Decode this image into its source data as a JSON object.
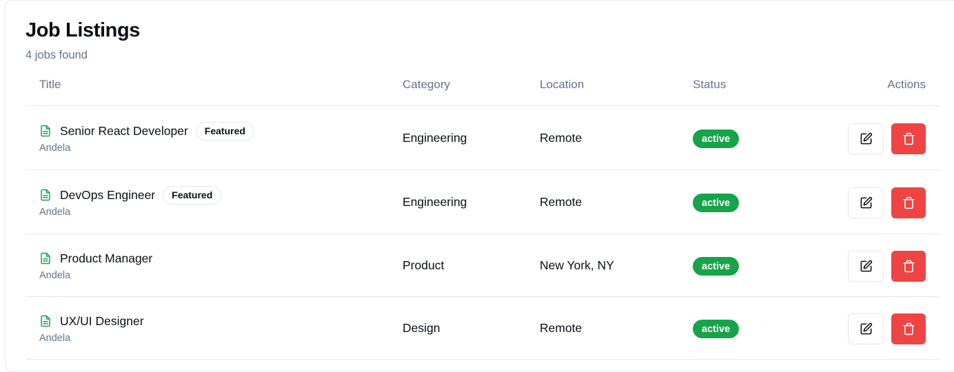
{
  "header": {
    "title": "Job Listings",
    "count_text": "4 jobs found"
  },
  "table": {
    "columns": {
      "title": "Title",
      "category": "Category",
      "location": "Location",
      "status": "Status",
      "actions": "Actions"
    },
    "rows": [
      {
        "title": "Senior React Developer",
        "badge": "Featured",
        "company": "Andela",
        "category": "Engineering",
        "location": "Remote",
        "status": "active"
      },
      {
        "title": "DevOps Engineer",
        "badge": "Featured",
        "company": "Andela",
        "category": "Engineering",
        "location": "Remote",
        "status": "active"
      },
      {
        "title": "Product Manager",
        "badge": "",
        "company": "Andela",
        "category": "Product",
        "location": "New York, NY",
        "status": "active"
      },
      {
        "title": "UX/UI Designer",
        "badge": "",
        "company": "Andela",
        "category": "Design",
        "location": "Remote",
        "status": "active"
      }
    ]
  },
  "colors": {
    "accent_green": "#16a34a",
    "delete_red": "#ef4444",
    "muted_text": "#64748b"
  },
  "icons": {
    "row_icon": "document-icon",
    "edit": "edit-icon",
    "delete": "trash-icon"
  }
}
